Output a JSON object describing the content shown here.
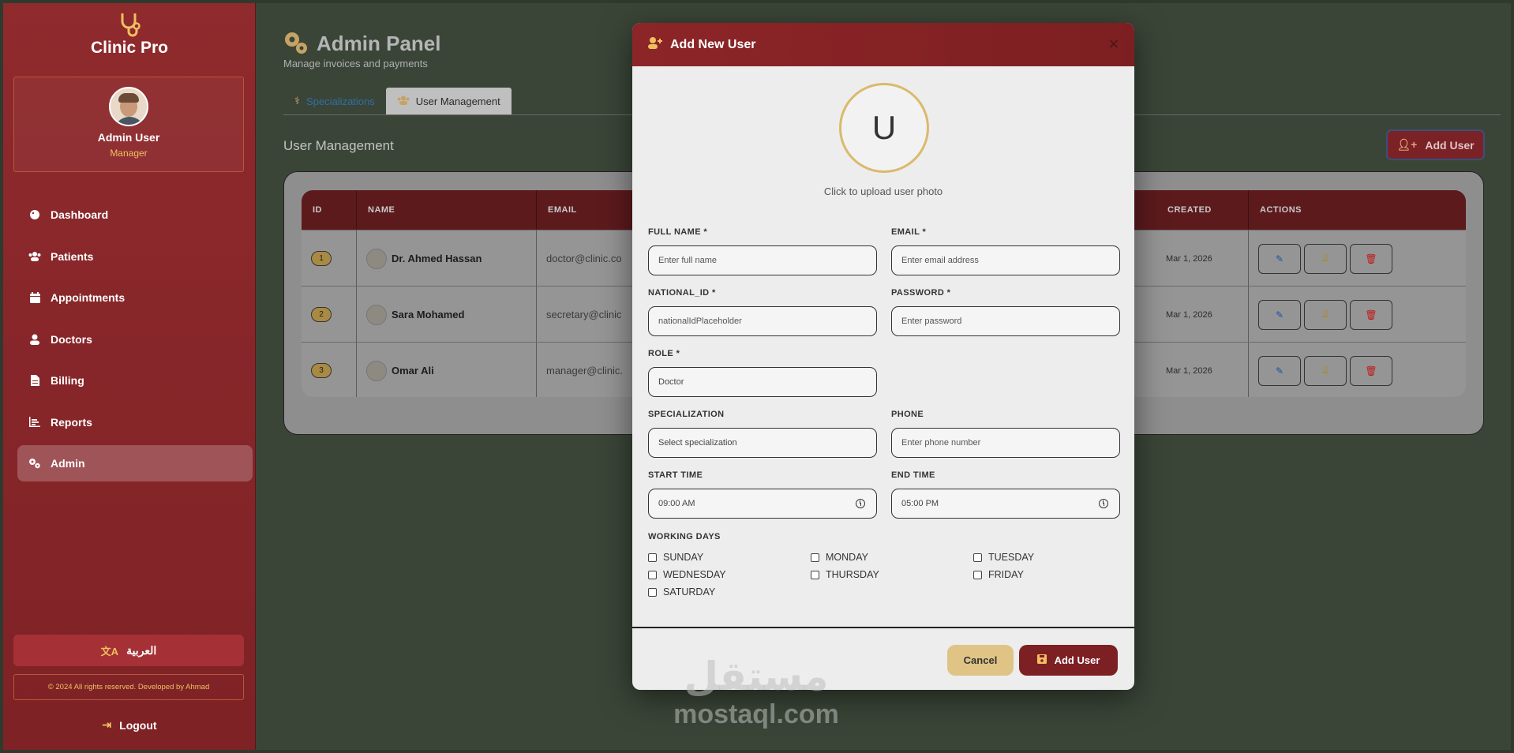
{
  "colors": {
    "sidebar": "#8f2a2d",
    "accent_gold": "#f0c060",
    "table_header": "#5d1a1d",
    "modal_header": "#8c2527"
  },
  "sidebar": {
    "brand": "Clinic Pro",
    "brand_icon": "stethoscope-icon",
    "user_name": "Admin User",
    "user_role": "Manager",
    "items": [
      {
        "label": "Dashboard",
        "icon": "palette-icon"
      },
      {
        "label": "Patients",
        "icon": "users-icon"
      },
      {
        "label": "Appointments",
        "icon": "calendar-icon"
      },
      {
        "label": "Doctors",
        "icon": "user-icon"
      },
      {
        "label": "Billing",
        "icon": "invoice-icon"
      },
      {
        "label": "Reports",
        "icon": "chart-icon"
      },
      {
        "label": "Admin",
        "icon": "gears-icon"
      }
    ],
    "active_item": "Admin",
    "language_label": "العربية",
    "footer": "© 2024 All rights reserved. Developed by Ahmad",
    "logout_label": "Logout"
  },
  "header": {
    "title": "Admin Panel",
    "subtitle": "Manage invoices and payments",
    "tabs": [
      {
        "label": "Specializations",
        "icon": "stethoscope-icon"
      },
      {
        "label": "User Management",
        "icon": "users-icon"
      }
    ],
    "active_tab": "User Management"
  },
  "user_management": {
    "section_title": "User Management",
    "add_button_label": "Add User",
    "columns": [
      "ID",
      "NAME",
      "EMAIL",
      "CREATED",
      "ACTIONS"
    ],
    "rows": [
      {
        "id": "1",
        "name": "Dr. Ahmed Hassan",
        "email": "doctor@clinic.co",
        "created": "Mar 1, 2026"
      },
      {
        "id": "2",
        "name": "Sara Mohamed",
        "email": "secretary@clinic",
        "created": "Mar 1, 2026"
      },
      {
        "id": "3",
        "name": "Omar Ali",
        "email": "manager@clinic.",
        "created": "Mar 1, 2026"
      }
    ]
  },
  "modal": {
    "title": "Add New User",
    "avatar_letter": "U",
    "upload_hint": "Click to upload user photo",
    "fields": {
      "full_name": {
        "label": "FULL NAME *",
        "placeholder": "Enter full name"
      },
      "email": {
        "label": "EMAIL *",
        "placeholder": "Enter email address"
      },
      "national_id": {
        "label": "NATIONAL_ID *",
        "placeholder": "nationalIdPlaceholder"
      },
      "password": {
        "label": "PASSWORD *",
        "placeholder": "Enter password"
      },
      "role": {
        "label": "ROLE *",
        "value": "Doctor"
      },
      "specialization": {
        "label": "SPECIALIZATION",
        "value": "Select specialization"
      },
      "phone": {
        "label": "PHONE",
        "placeholder": "Enter phone number"
      },
      "start_time": {
        "label": "START TIME",
        "value": "09:00 AM"
      },
      "end_time": {
        "label": "END TIME",
        "value": "05:00 PM"
      }
    },
    "working_days_label": "WORKING DAYS",
    "days": [
      "SUNDAY",
      "MONDAY",
      "TUESDAY",
      "WEDNESDAY",
      "THURSDAY",
      "FRIDAY",
      "SATURDAY"
    ],
    "cancel_label": "Cancel",
    "submit_label": "Add User"
  },
  "watermark": {
    "arabic": "مستقل",
    "latin": "mostaql.com"
  }
}
